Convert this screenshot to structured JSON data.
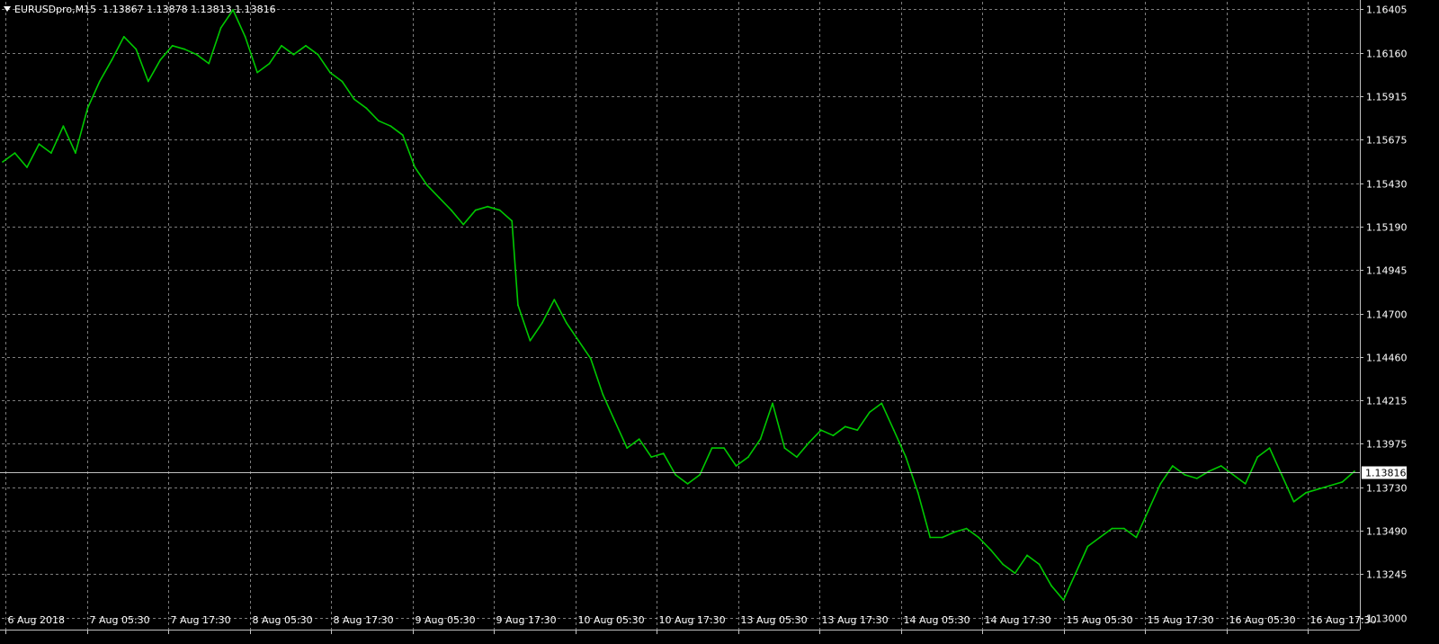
{
  "header": {
    "symbol": "EURUSDpro,M15",
    "ohlc": "1.13867 1.13878 1.13813 1.13816"
  },
  "colors": {
    "background": "#000000",
    "price_line": "#00c800",
    "grid": "#c0c0c0",
    "axis_text": "#ffffff",
    "bid_line": "#c0c0c0",
    "bid_label_bg": "#ffffff",
    "bid_label_text": "#000000"
  },
  "chart_data": {
    "type": "line",
    "symbol": "EURUSDpro",
    "timeframe": "M15",
    "grid": true,
    "current_price": 1.13816,
    "current_price_label": "1.13816",
    "ylim": [
      1.13,
      1.16405
    ],
    "y_ticks": [
      "1.16405",
      "1.16160",
      "1.15915",
      "1.15675",
      "1.15430",
      "1.15190",
      "1.14945",
      "1.14700",
      "1.14460",
      "1.14215",
      "1.13975",
      "1.13730",
      "1.13490",
      "1.13245",
      "1.13000"
    ],
    "x_ticks": [
      "6 Aug 2018",
      "7 Aug 05:30",
      "7 Aug 17:30",
      "8 Aug 05:30",
      "8 Aug 17:30",
      "9 Aug 05:30",
      "9 Aug 17:30",
      "10 Aug 05:30",
      "10 Aug 17:30",
      "13 Aug 05:30",
      "13 Aug 17:30",
      "14 Aug 05:30",
      "14 Aug 17:30",
      "15 Aug 05:30",
      "15 Aug 17:30",
      "16 Aug 05:30",
      "16 Aug 17:30"
    ],
    "series": [
      {
        "values": [
          [
            0,
            1.1555
          ],
          [
            4,
            1.156
          ],
          [
            8,
            1.1552
          ],
          [
            12,
            1.1565
          ],
          [
            16,
            1.156
          ],
          [
            20,
            1.1575
          ],
          [
            24,
            1.156
          ],
          [
            28,
            1.1585
          ],
          [
            32,
            1.16
          ],
          [
            36,
            1.1612
          ],
          [
            40,
            1.1625
          ],
          [
            44,
            1.1618
          ],
          [
            48,
            1.16
          ],
          [
            52,
            1.1612
          ],
          [
            56,
            1.162
          ],
          [
            60,
            1.1618
          ],
          [
            64,
            1.1615
          ],
          [
            68,
            1.161
          ],
          [
            72,
            1.163
          ],
          [
            76,
            1.164
          ],
          [
            80,
            1.1625
          ],
          [
            84,
            1.1605
          ],
          [
            88,
            1.161
          ],
          [
            92,
            1.162
          ],
          [
            96,
            1.1615
          ],
          [
            100,
            1.162
          ],
          [
            104,
            1.1615
          ],
          [
            108,
            1.1605
          ],
          [
            112,
            1.16
          ],
          [
            116,
            1.159
          ],
          [
            120,
            1.1585
          ],
          [
            124,
            1.1578
          ],
          [
            128,
            1.1575
          ],
          [
            132,
            1.157
          ],
          [
            136,
            1.1552
          ],
          [
            140,
            1.1542
          ],
          [
            144,
            1.1535
          ],
          [
            148,
            1.1528
          ],
          [
            152,
            1.152
          ],
          [
            156,
            1.1528
          ],
          [
            160,
            1.153
          ],
          [
            164,
            1.1528
          ],
          [
            168,
            1.1522
          ],
          [
            170,
            1.1475
          ],
          [
            174,
            1.1455
          ],
          [
            178,
            1.1465
          ],
          [
            182,
            1.1478
          ],
          [
            186,
            1.1465
          ],
          [
            190,
            1.1455
          ],
          [
            194,
            1.1445
          ],
          [
            198,
            1.1425
          ],
          [
            202,
            1.141
          ],
          [
            206,
            1.1395
          ],
          [
            210,
            1.14
          ],
          [
            214,
            1.139
          ],
          [
            218,
            1.1392
          ],
          [
            222,
            1.138
          ],
          [
            226,
            1.1375
          ],
          [
            230,
            1.138
          ],
          [
            234,
            1.1395
          ],
          [
            238,
            1.1395
          ],
          [
            242,
            1.1385
          ],
          [
            246,
            1.139
          ],
          [
            250,
            1.14
          ],
          [
            254,
            1.142
          ],
          [
            258,
            1.1395
          ],
          [
            262,
            1.139
          ],
          [
            266,
            1.1398
          ],
          [
            270,
            1.1405
          ],
          [
            274,
            1.1402
          ],
          [
            278,
            1.1407
          ],
          [
            282,
            1.1405
          ],
          [
            286,
            1.1415
          ],
          [
            290,
            1.142
          ],
          [
            294,
            1.1405
          ],
          [
            298,
            1.139
          ],
          [
            302,
            1.137
          ],
          [
            306,
            1.1345
          ],
          [
            310,
            1.1345
          ],
          [
            314,
            1.1348
          ],
          [
            318,
            1.135
          ],
          [
            322,
            1.1345
          ],
          [
            326,
            1.1338
          ],
          [
            330,
            1.133
          ],
          [
            334,
            1.1325
          ],
          [
            338,
            1.1335
          ],
          [
            342,
            1.133
          ],
          [
            346,
            1.1318
          ],
          [
            350,
            1.131
          ],
          [
            354,
            1.1325
          ],
          [
            358,
            1.134
          ],
          [
            362,
            1.1345
          ],
          [
            366,
            1.135
          ],
          [
            370,
            1.135
          ],
          [
            374,
            1.1345
          ],
          [
            378,
            1.136
          ],
          [
            382,
            1.1375
          ],
          [
            386,
            1.1385
          ],
          [
            390,
            1.138
          ],
          [
            394,
            1.1378
          ],
          [
            398,
            1.1382
          ],
          [
            402,
            1.1385
          ],
          [
            406,
            1.138
          ],
          [
            410,
            1.1375
          ],
          [
            414,
            1.139
          ],
          [
            418,
            1.1395
          ],
          [
            422,
            1.138
          ],
          [
            426,
            1.1365
          ],
          [
            430,
            1.137
          ],
          [
            434,
            1.1372
          ],
          [
            438,
            1.1374
          ],
          [
            442,
            1.1376
          ],
          [
            446,
            1.1382
          ]
        ]
      }
    ]
  }
}
